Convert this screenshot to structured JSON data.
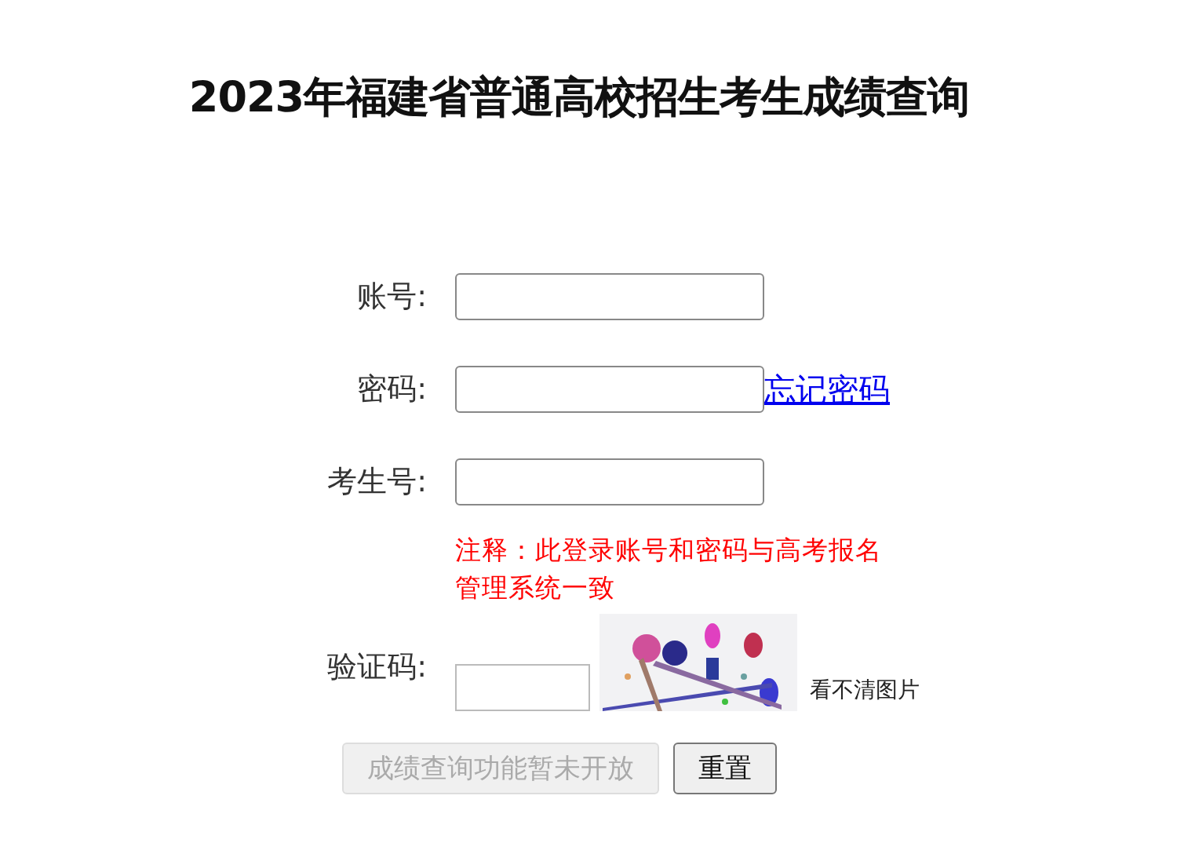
{
  "title": "2023年福建省普通高校招生考生成绩查询",
  "fields": [
    {
      "label": "账号:"
    },
    {
      "label": "密码:",
      "link": "忘记密码"
    },
    {
      "label": "考生号:"
    }
  ],
  "note": "注释：此登录账号和密码与高考报名管理系统一致",
  "captcha": {
    "label": "验证码:",
    "refresh_text": "看不清图片"
  },
  "buttons": [
    {
      "label": "成绩查询功能暂未开放",
      "disabled": true
    },
    {
      "label": "重置",
      "disabled": false
    }
  ]
}
